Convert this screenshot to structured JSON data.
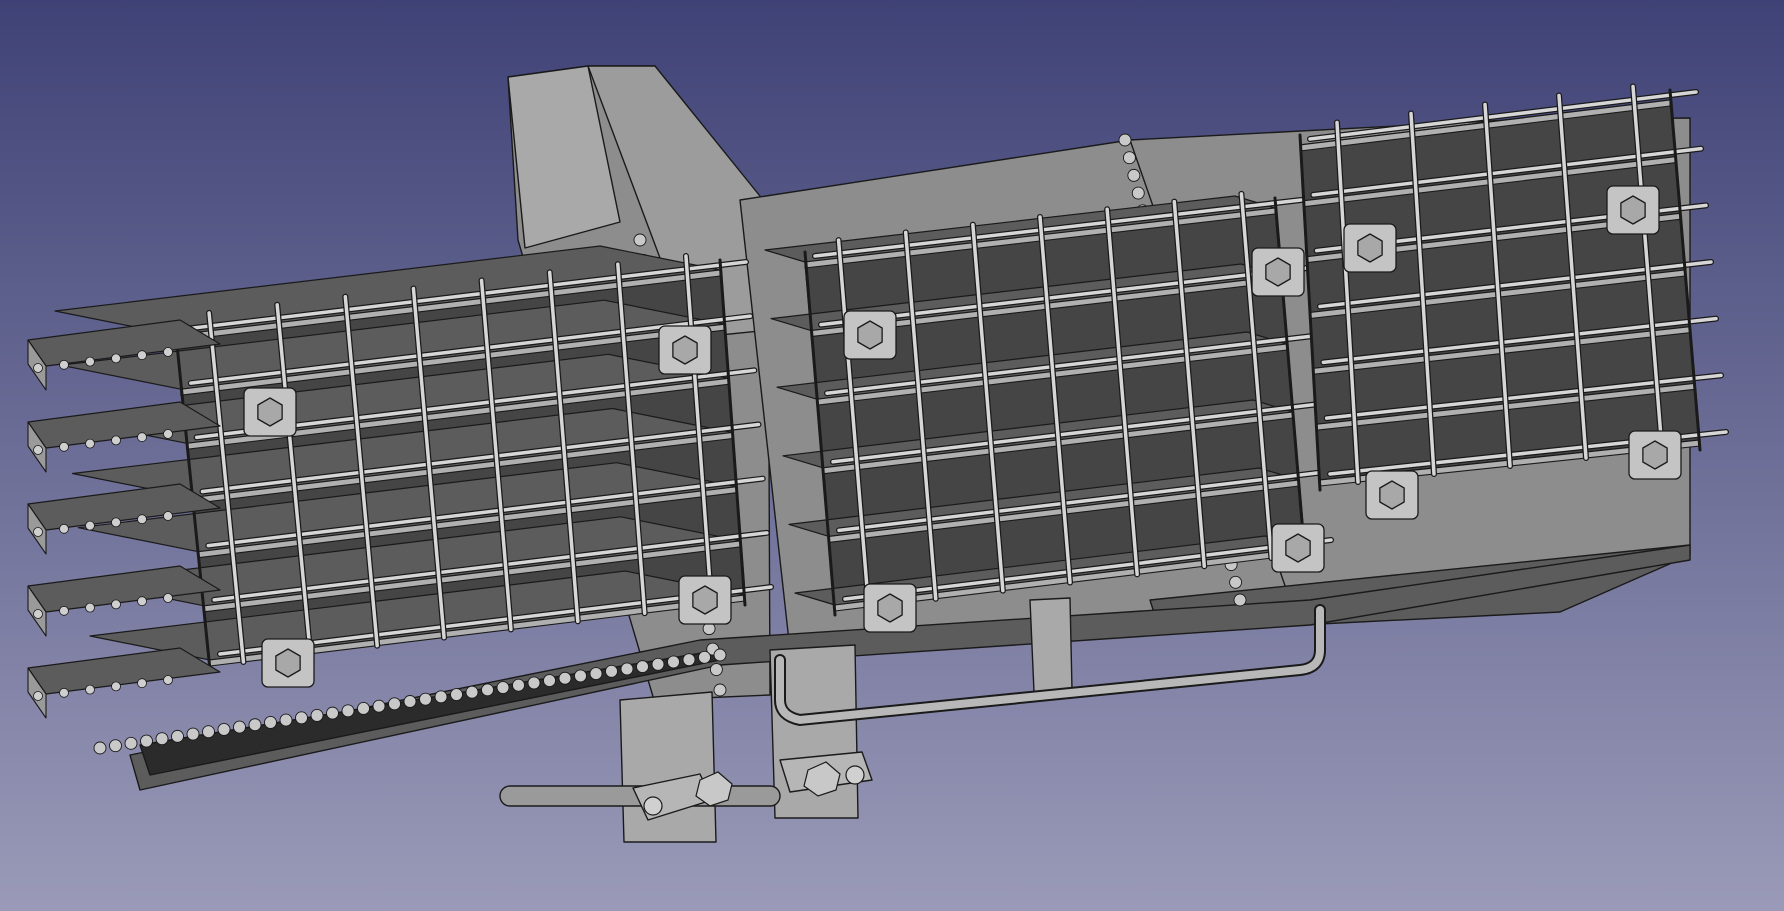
{
  "app": {
    "view": "3d-viewport"
  },
  "viewport": {
    "background_top": "#3f4276",
    "background_bottom": "#9a9ab8"
  },
  "model": {
    "face_light": "#a9a9a9",
    "face_mid": "#8d8d8d",
    "face_dark": "#5c5c5c",
    "face_shadow": "#454545",
    "edge": "#1a1a1a",
    "bar": "#d6d6d6",
    "modules": [
      {
        "name": "left",
        "plates": 7,
        "vertical_bars": 8
      },
      {
        "name": "middle",
        "plates": 6,
        "vertical_bars": 7
      },
      {
        "name": "right",
        "plates": 7,
        "vertical_bars": 5
      }
    ]
  }
}
